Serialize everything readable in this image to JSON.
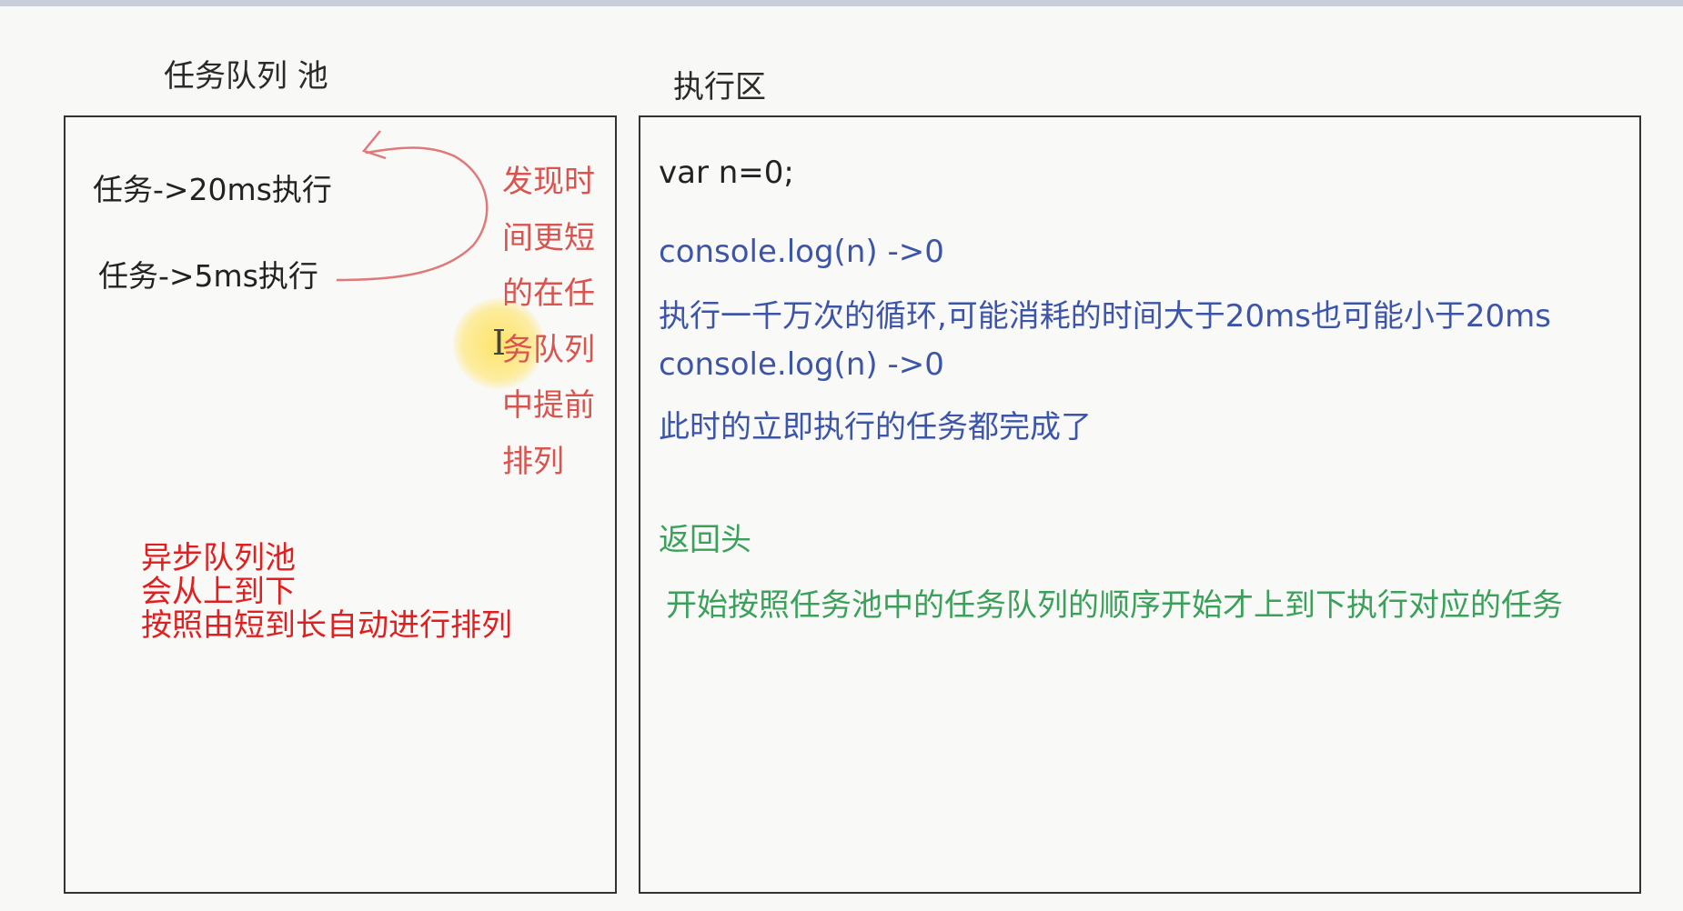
{
  "headings": {
    "task_pool": "任务队列 池",
    "execution_area": "执行区"
  },
  "task_pool": {
    "tasks": [
      "任务->20ms执行",
      "任务->5ms执行"
    ],
    "reorder_note": [
      "发现时",
      "间更短",
      "的在任",
      "务队列",
      "中提前",
      "排列"
    ],
    "async_note": [
      "异步队列池",
      "会从上到下",
      "按照由短到长自动进行排列"
    ]
  },
  "execution": {
    "declaration": "var n=0;",
    "log_first": "console.log(n) ->0",
    "loop_note": "执行一千万次的循环,可能消耗的时间大于20ms也可能小于20ms",
    "log_second": "console.log(n) ->0",
    "done_note": "此时的立即执行的任务都完成了",
    "go_back": "返回头",
    "run_queue": "开始按照任务池中的任务队列的顺序开始才上到下执行对应的任务"
  },
  "colors": {
    "red_annotation": "#d9534f",
    "async_note": "#e02020",
    "blue_code": "#3d55a8",
    "green_text": "#3aa05a",
    "cursor_highlight": "#ffe050"
  }
}
